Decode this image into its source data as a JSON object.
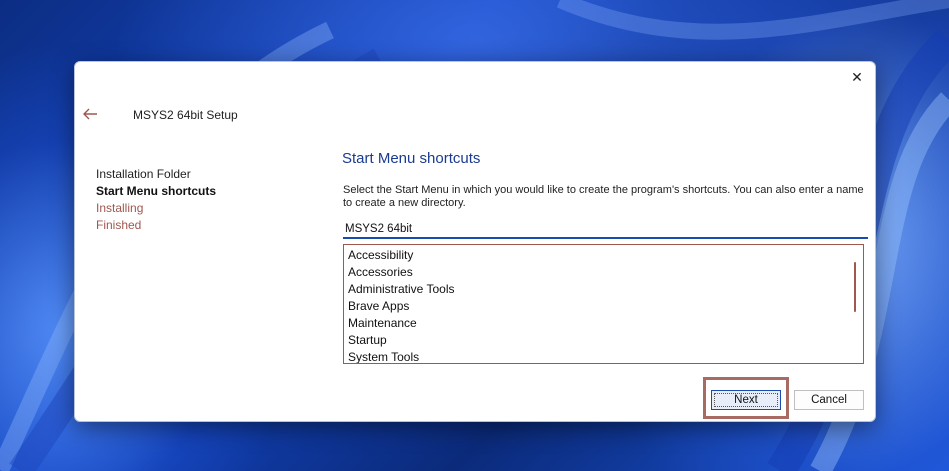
{
  "window": {
    "title": "MSYS2 64bit Setup",
    "close_glyph": "✕"
  },
  "steps": [
    {
      "label": "Installation Folder",
      "state": "done"
    },
    {
      "label": "Start Menu shortcuts",
      "state": "current"
    },
    {
      "label": "Installing",
      "state": "pending"
    },
    {
      "label": "Finished",
      "state": "pending"
    }
  ],
  "page": {
    "heading": "Start Menu shortcuts",
    "description": "Select the Start Menu in which you would like to create the program's shortcuts. You can also enter a name to create a new directory.",
    "folder_value": "MSYS2 64bit"
  },
  "folders": [
    "Accessibility",
    "Accessories",
    "Administrative Tools",
    "Brave Apps",
    "Maintenance",
    "Startup",
    "System Tools"
  ],
  "buttons": {
    "next": "Next",
    "cancel": "Cancel"
  },
  "colors": {
    "heading": "#1a3b8f",
    "pending_step": "#a0574e",
    "input_underline": "#1a4bb0",
    "highlight": "#a86b63"
  }
}
